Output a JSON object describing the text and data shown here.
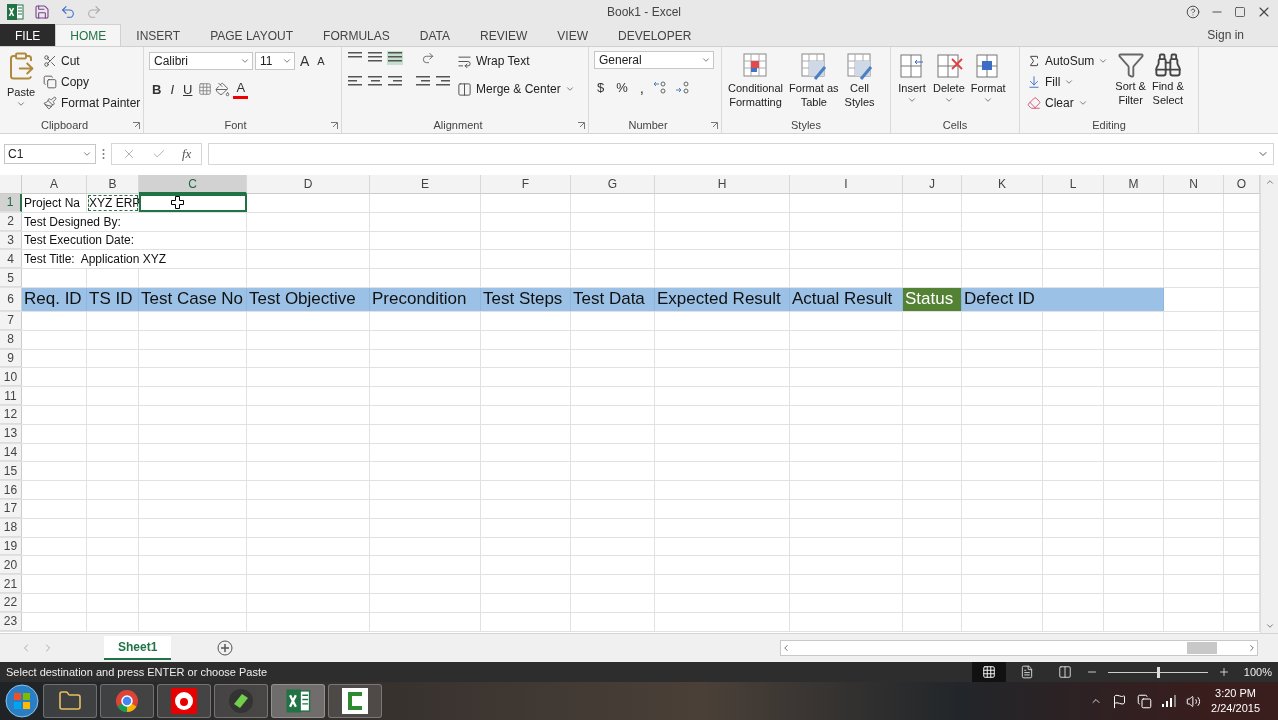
{
  "window": {
    "title": "Book1 - Excel"
  },
  "ribbon_tabs": [
    {
      "label": "FILE",
      "kind": "file",
      "selected": false
    },
    {
      "label": "HOME",
      "kind": "tab",
      "selected": true
    },
    {
      "label": "INSERT",
      "kind": "tab",
      "selected": false
    },
    {
      "label": "PAGE LAYOUT",
      "kind": "tab",
      "selected": false
    },
    {
      "label": "FORMULAS",
      "kind": "tab",
      "selected": false
    },
    {
      "label": "DATA",
      "kind": "tab",
      "selected": false
    },
    {
      "label": "REVIEW",
      "kind": "tab",
      "selected": false
    },
    {
      "label": "VIEW",
      "kind": "tab",
      "selected": false
    },
    {
      "label": "DEVELOPER",
      "kind": "tab",
      "selected": false
    }
  ],
  "sign_in": "Sign in",
  "clipboard": {
    "label": "Clipboard",
    "paste": "Paste",
    "items": [
      "Cut",
      "Copy",
      "Format Painter"
    ]
  },
  "font": {
    "label": "Font",
    "name": "Calibri",
    "size": "11",
    "grow": "A",
    "shrink": "A",
    "styles": [
      "B",
      "I",
      "U"
    ],
    "color_letter": "A"
  },
  "alignment": {
    "label": "Alignment",
    "wrap": "Wrap Text",
    "merge": "Merge & Center"
  },
  "number": {
    "label": "Number",
    "format": "General",
    "symbols": [
      "$",
      "%",
      ","
    ]
  },
  "styles": {
    "label": "Styles",
    "buttons": [
      [
        "Conditional",
        "Formatting"
      ],
      [
        "Format as",
        "Table"
      ],
      [
        "Cell",
        "Styles"
      ]
    ]
  },
  "cells_group": {
    "label": "Cells",
    "buttons": [
      "Insert",
      "Delete",
      "Format"
    ]
  },
  "editing": {
    "label": "Editing",
    "items": [
      "AutoSum",
      "Fill",
      "Clear"
    ],
    "buttons": [
      [
        "Sort &",
        "Filter"
      ],
      [
        "Find &",
        "Select"
      ]
    ]
  },
  "formula_bar": {
    "name_box": "C1",
    "function_label": "fx"
  },
  "columns": [
    {
      "label": "A",
      "selected": false
    },
    {
      "label": "B",
      "selected": false
    },
    {
      "label": "C",
      "selected": true
    },
    {
      "label": "D",
      "selected": false
    },
    {
      "label": "E",
      "selected": false
    },
    {
      "label": "F",
      "selected": false
    },
    {
      "label": "G",
      "selected": false
    },
    {
      "label": "H",
      "selected": false
    },
    {
      "label": "I",
      "selected": false
    },
    {
      "label": "J",
      "selected": false
    },
    {
      "label": "K",
      "selected": false
    },
    {
      "label": "L",
      "selected": false
    },
    {
      "label": "M",
      "selected": false
    },
    {
      "label": "N",
      "selected": false
    },
    {
      "label": "O",
      "selected": false
    }
  ],
  "rows": [
    {
      "number": "1",
      "kind": "plain",
      "selected": true,
      "cells": [
        {
          "text": "Project Na",
          "selected": false,
          "copied": false
        },
        {
          "text": "XYZ ERP",
          "selected": false,
          "copied": true
        },
        {
          "selected": true,
          "copied": false
        }
      ]
    },
    {
      "number": "2",
      "kind": "plain",
      "selected": false,
      "cells": [
        {
          "text": "Test Designed By:",
          "selected": false,
          "copied": false
        }
      ]
    },
    {
      "number": "3",
      "kind": "plain",
      "selected": false,
      "cells": [
        {
          "text": "Test Execution Date:",
          "selected": false,
          "copied": false
        }
      ]
    },
    {
      "number": "4",
      "kind": "plain",
      "selected": false,
      "cells": [
        {
          "text": "Test Title:  Application XYZ",
          "selected": false,
          "copied": false
        }
      ]
    },
    {
      "number": "5",
      "kind": "plain",
      "selected": false
    },
    {
      "number": "6",
      "kind": "header",
      "selected": false,
      "cells": [
        {
          "text": "Req. ID",
          "color": "#9bc2e6",
          "selected": false,
          "copied": false
        },
        {
          "text": "TS ID",
          "color": "#9bc2e6",
          "selected": false,
          "copied": false
        },
        {
          "text": "Test Case No",
          "color": "#9bc2e6",
          "selected": false,
          "copied": false
        },
        {
          "text": "Test Objective",
          "color": "#9bc2e6",
          "selected": false,
          "copied": false
        },
        {
          "text": "Precondition",
          "color": "#9bc2e6",
          "selected": false,
          "copied": false
        },
        {
          "text": "Test Steps",
          "color": "#9bc2e6",
          "selected": false,
          "copied": false
        },
        {
          "text": "Test Data",
          "color": "#9bc2e6",
          "selected": false,
          "copied": false
        },
        {
          "text": "Expected Result",
          "color": "#9bc2e6",
          "selected": false,
          "copied": false
        },
        {
          "text": "Actual Result",
          "color": "#9bc2e6",
          "selected": false,
          "copied": false
        },
        {
          "text": "Status",
          "color": "#548235",
          "selected": false,
          "copied": false
        },
        {
          "text": "Defect ID",
          "color": "#9bc2e6",
          "selected": false,
          "copied": false
        }
      ]
    },
    {
      "number": "7",
      "kind": "plain",
      "selected": false
    },
    {
      "number": "8",
      "kind": "plain",
      "selected": false
    },
    {
      "number": "9",
      "kind": "plain",
      "selected": false
    },
    {
      "number": "10",
      "kind": "plain",
      "selected": false
    },
    {
      "number": "11",
      "kind": "plain",
      "selected": false
    },
    {
      "number": "12",
      "kind": "plain",
      "selected": false
    },
    {
      "number": "13",
      "kind": "plain",
      "selected": false
    },
    {
      "number": "14",
      "kind": "plain",
      "selected": false
    },
    {
      "number": "15",
      "kind": "plain",
      "selected": false
    },
    {
      "number": "16",
      "kind": "plain",
      "selected": false
    },
    {
      "number": "17",
      "kind": "plain",
      "selected": false
    },
    {
      "number": "18",
      "kind": "plain",
      "selected": false
    },
    {
      "number": "19",
      "kind": "plain",
      "selected": false
    },
    {
      "number": "20",
      "kind": "plain",
      "selected": false
    },
    {
      "number": "21",
      "kind": "plain",
      "selected": false
    },
    {
      "number": "22",
      "kind": "plain",
      "selected": false
    },
    {
      "number": "23",
      "kind": "plain",
      "selected": false
    }
  ],
  "sheet_tabs": [
    {
      "label": "Sheet1",
      "selected": true
    }
  ],
  "status_bar": {
    "message": "Select destination and press ENTER or choose Paste",
    "zoom": {
      "level": 0.5,
      "reading": "100%"
    }
  },
  "taskbar": {
    "time": "3:20 PM",
    "date": "2/24/2015"
  }
}
